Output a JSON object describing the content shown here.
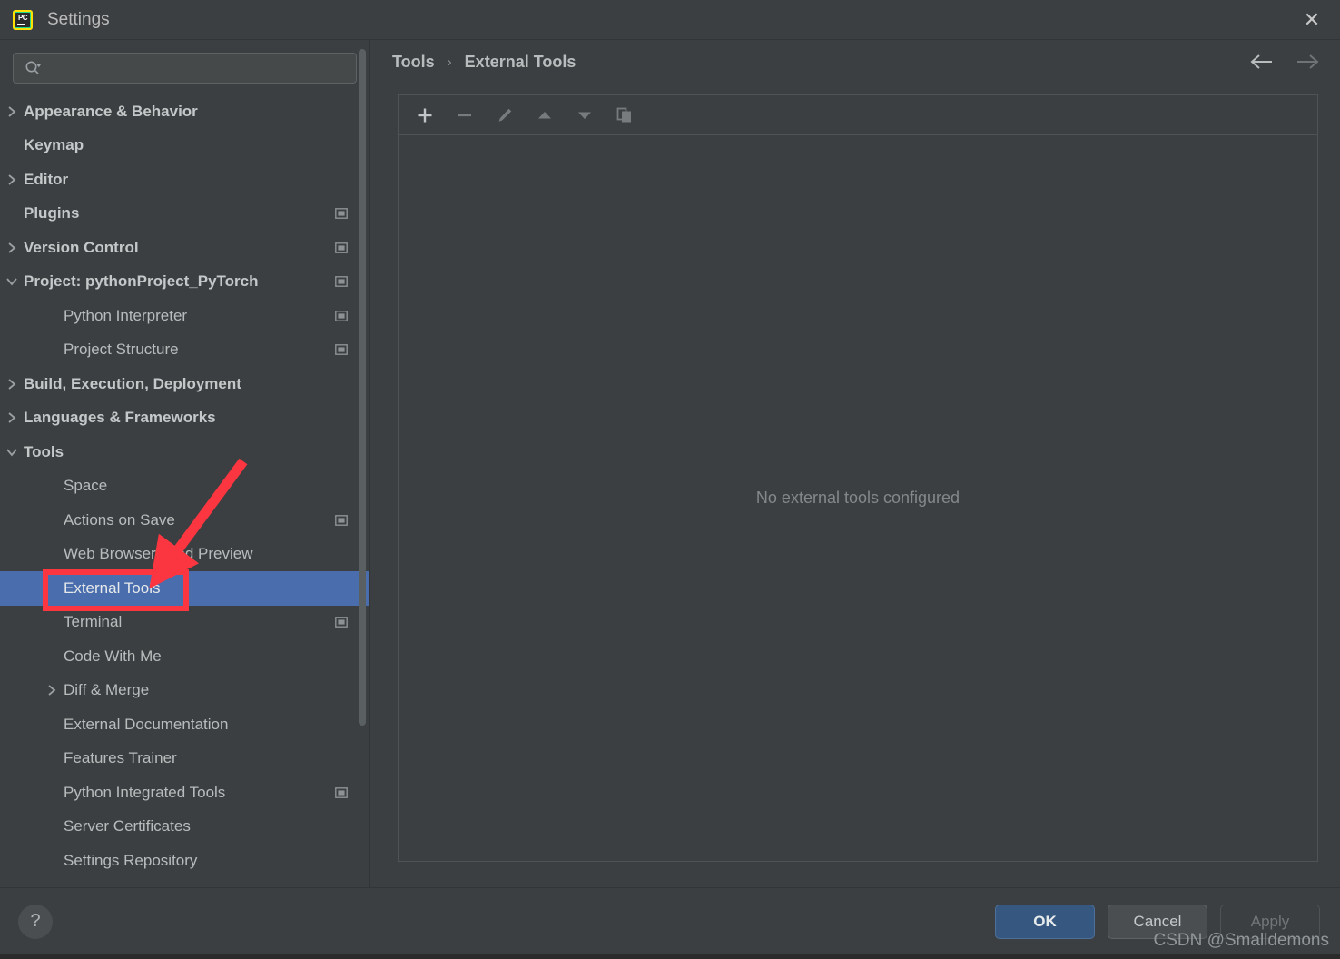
{
  "window": {
    "title": "Settings",
    "app_icon": "pycharm-icon",
    "app_icon_text": "PC",
    "close_label": "✕"
  },
  "search": {
    "value": "",
    "placeholder": "",
    "icon": "search-icon"
  },
  "sidebar": {
    "items": [
      {
        "label": "Appearance & Behavior",
        "level": 0,
        "chevron": "collapsed",
        "badge": false,
        "selected": false
      },
      {
        "label": "Keymap",
        "level": 0,
        "chevron": "none",
        "badge": false,
        "selected": false
      },
      {
        "label": "Editor",
        "level": 0,
        "chevron": "collapsed",
        "badge": false,
        "selected": false
      },
      {
        "label": "Plugins",
        "level": 0,
        "chevron": "none",
        "badge": true,
        "selected": false
      },
      {
        "label": "Version Control",
        "level": 0,
        "chevron": "collapsed",
        "badge": true,
        "selected": false
      },
      {
        "label": "Project: pythonProject_PyTorch",
        "level": 0,
        "chevron": "expanded",
        "badge": true,
        "selected": false
      },
      {
        "label": "Python Interpreter",
        "level": 1,
        "chevron": "none",
        "badge": true,
        "selected": false
      },
      {
        "label": "Project Structure",
        "level": 1,
        "chevron": "none",
        "badge": true,
        "selected": false
      },
      {
        "label": "Build, Execution, Deployment",
        "level": 0,
        "chevron": "collapsed",
        "badge": false,
        "selected": false
      },
      {
        "label": "Languages & Frameworks",
        "level": 0,
        "chevron": "collapsed",
        "badge": false,
        "selected": false
      },
      {
        "label": "Tools",
        "level": 0,
        "chevron": "expanded",
        "badge": false,
        "selected": false
      },
      {
        "label": "Space",
        "level": 1,
        "chevron": "none",
        "badge": false,
        "selected": false
      },
      {
        "label": "Actions on Save",
        "level": 1,
        "chevron": "none",
        "badge": true,
        "selected": false
      },
      {
        "label": "Web Browsers and Preview",
        "level": 1,
        "chevron": "none",
        "badge": false,
        "selected": false
      },
      {
        "label": "External Tools",
        "level": 1,
        "chevron": "none",
        "badge": false,
        "selected": true
      },
      {
        "label": "Terminal",
        "level": 1,
        "chevron": "none",
        "badge": true,
        "selected": false
      },
      {
        "label": "Code With Me",
        "level": 1,
        "chevron": "none",
        "badge": false,
        "selected": false
      },
      {
        "label": "Diff & Merge",
        "level": 1,
        "chevron": "collapsed",
        "badge": false,
        "selected": false
      },
      {
        "label": "External Documentation",
        "level": 1,
        "chevron": "none",
        "badge": false,
        "selected": false
      },
      {
        "label": "Features Trainer",
        "level": 1,
        "chevron": "none",
        "badge": false,
        "selected": false
      },
      {
        "label": "Python Integrated Tools",
        "level": 1,
        "chevron": "none",
        "badge": true,
        "selected": false
      },
      {
        "label": "Server Certificates",
        "level": 1,
        "chevron": "none",
        "badge": false,
        "selected": false
      },
      {
        "label": "Settings Repository",
        "level": 1,
        "chevron": "none",
        "badge": false,
        "selected": false
      }
    ]
  },
  "header": {
    "breadcrumb": [
      "Tools",
      "External Tools"
    ],
    "separator": "›",
    "back_icon": "arrow-left-icon",
    "forward_icon": "arrow-right-icon"
  },
  "toolbar": {
    "buttons": [
      {
        "name": "add-tool-button",
        "icon": "plus-icon",
        "enabled": true
      },
      {
        "name": "remove-tool-button",
        "icon": "minus-icon",
        "enabled": false
      },
      {
        "name": "edit-tool-button",
        "icon": "pencil-icon",
        "enabled": false
      },
      {
        "name": "move-up-button",
        "icon": "arrow-up-icon",
        "enabled": false
      },
      {
        "name": "move-down-button",
        "icon": "arrow-down-icon",
        "enabled": false
      },
      {
        "name": "copy-tool-button",
        "icon": "copy-icon",
        "enabled": false
      }
    ]
  },
  "content": {
    "empty_message": "No external tools configured"
  },
  "footer": {
    "help_label": "?",
    "ok_label": "OK",
    "cancel_label": "Cancel",
    "apply_label": "Apply"
  },
  "watermark": {
    "text": "CSDN @Smalldemons"
  },
  "colors": {
    "selection_blue": "#4a6dae",
    "primary_button": "#365880",
    "annotation_red": "#fb3640",
    "panel_bg": "#3c3f41",
    "text": "#b9bcbd"
  }
}
